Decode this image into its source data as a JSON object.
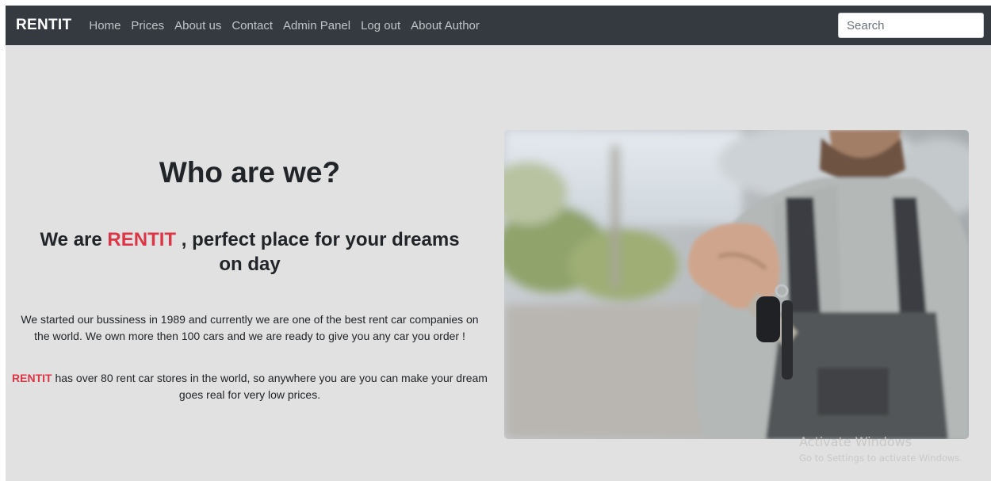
{
  "navbar": {
    "brand": "RENTIT",
    "links": [
      "Home",
      "Prices",
      "About us",
      "Contact",
      "Admin Panel",
      "Log out",
      "About Author"
    ],
    "search_placeholder": "Search"
  },
  "main": {
    "title": "Who are we?",
    "subtitle_prefix": "We are",
    "subtitle_brand": "RENTIT",
    "subtitle_suffix": ", perfect place for your dreams on day",
    "paragraph1": "We started our bussiness in 1989 and currently we are one of the best rent car companies on the world. We own more then 100 cars and we are ready to give you any car you order !",
    "paragraph2_brand": "RENTIT",
    "paragraph2_text": " has over 80 rent car stores in the world, so anywhere you are you can make your dream goes real for very low prices."
  },
  "image": {
    "icon": "man-handing-car-keys-photo"
  },
  "watermark": {
    "line1": "Activate Windows",
    "line2": "Go to Settings to activate Windows."
  },
  "colors": {
    "navbar_bg": "#343a40",
    "page_bg": "#e1e1e1",
    "accent": "#dc3545",
    "text": "#212529"
  }
}
